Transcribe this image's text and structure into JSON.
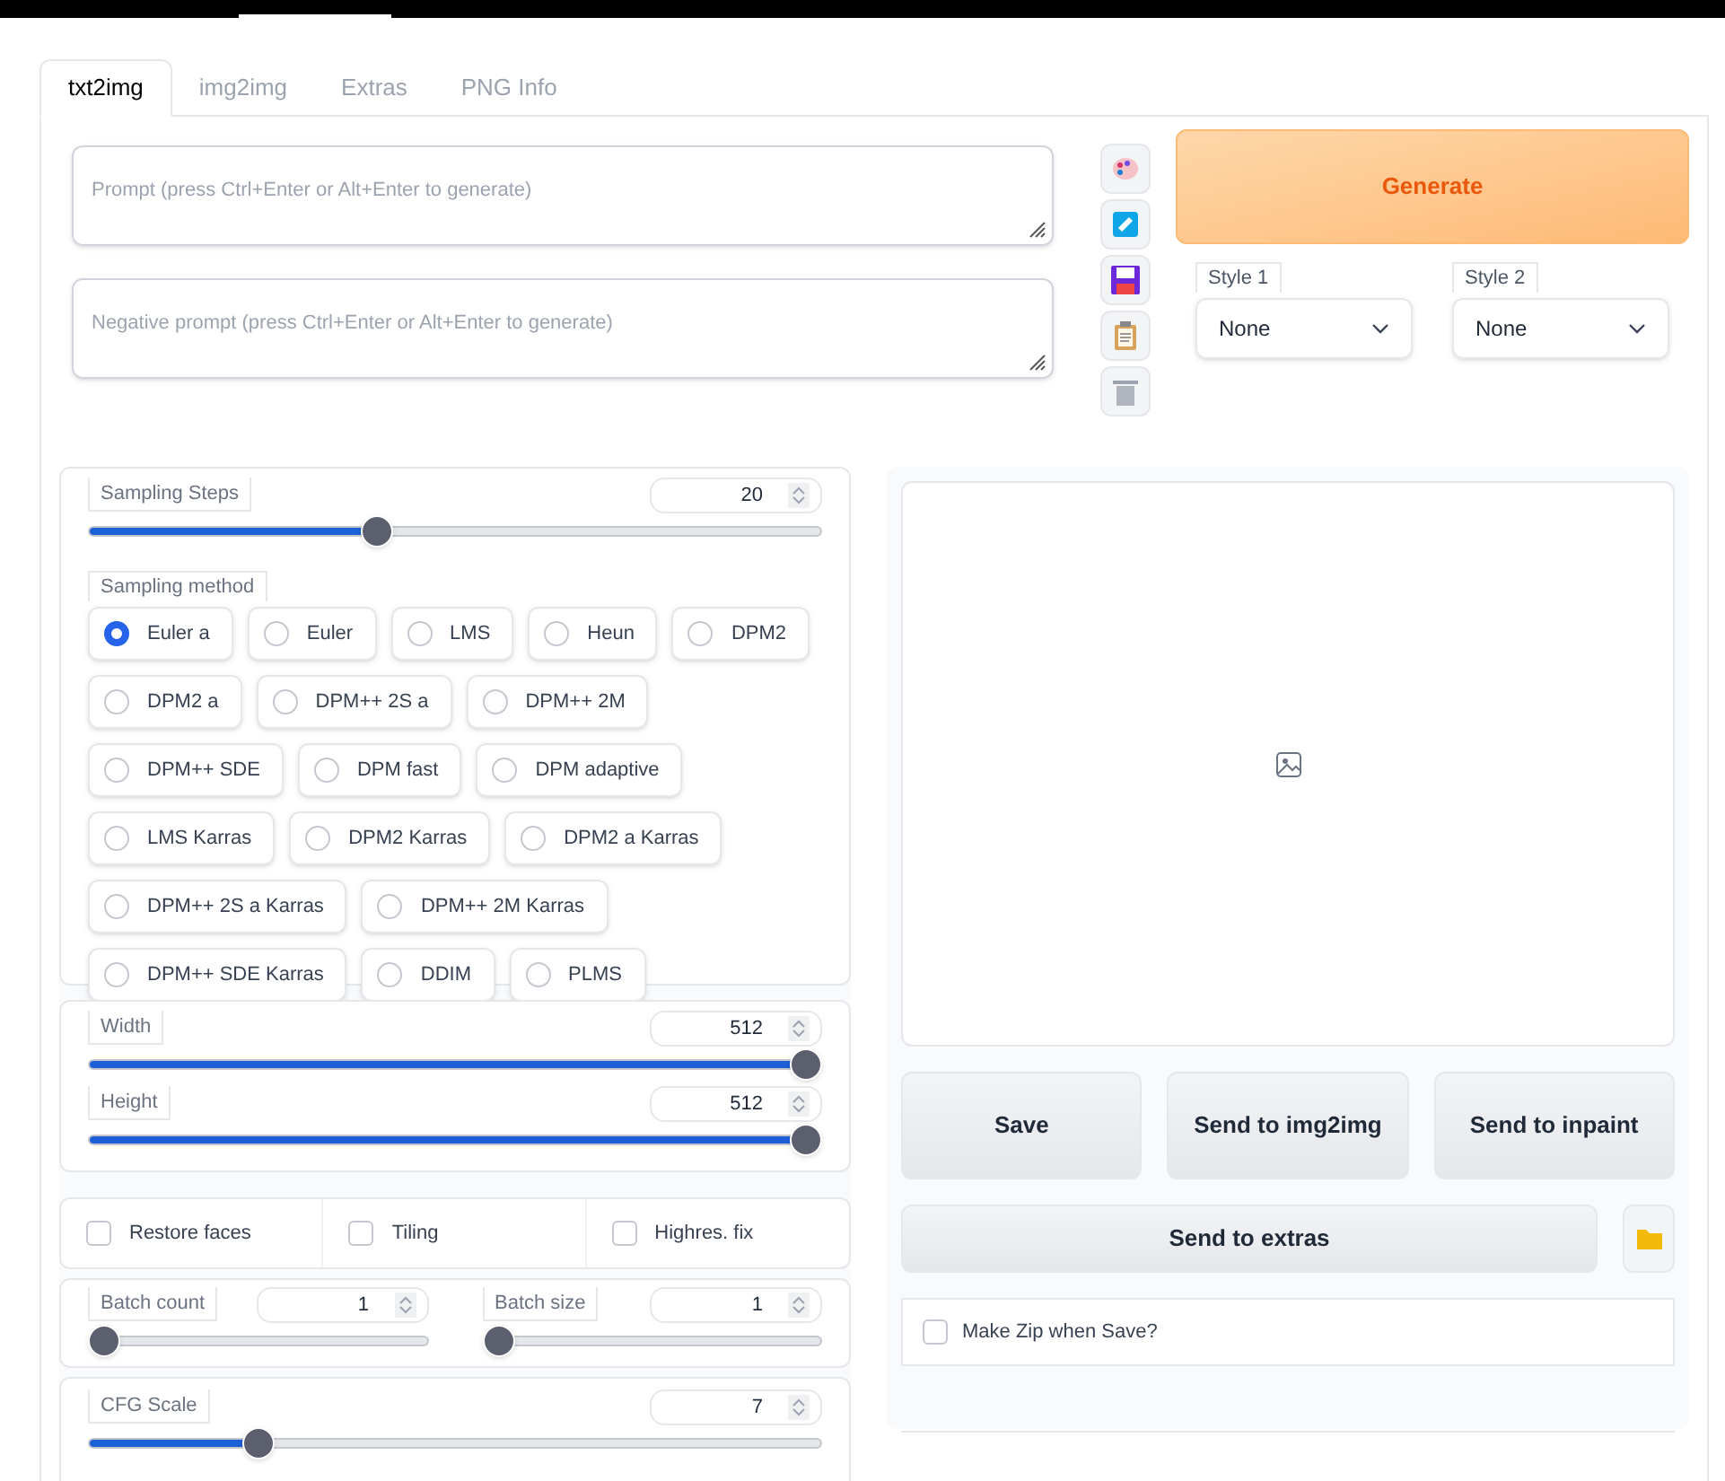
{
  "tabs": [
    {
      "label": "txt2img",
      "selected": true
    },
    {
      "label": "img2img",
      "selected": false
    },
    {
      "label": "Extras",
      "selected": false
    },
    {
      "label": "PNG Info",
      "selected": false
    }
  ],
  "prompt": {
    "placeholder": "Prompt (press Ctrl+Enter or Alt+Enter to generate)"
  },
  "negative_prompt": {
    "placeholder": "Negative prompt (press Ctrl+Enter or Alt+Enter to generate)"
  },
  "generate_button": "Generate",
  "styles": [
    {
      "label": "Style 1",
      "value": "None"
    },
    {
      "label": "Style 2",
      "value": "None"
    }
  ],
  "sampling_steps": {
    "label": "Sampling Steps",
    "value": "20",
    "level": 0.39
  },
  "sampling_method": {
    "label": "Sampling method",
    "options": [
      {
        "label": "Euler a",
        "selected": true
      },
      {
        "label": "Euler",
        "selected": false
      },
      {
        "label": "LMS",
        "selected": false
      },
      {
        "label": "Heun",
        "selected": false
      },
      {
        "label": "DPM2",
        "selected": false
      },
      {
        "label": "DPM2 a",
        "selected": false
      },
      {
        "label": "DPM++ 2S a",
        "selected": false
      },
      {
        "label": "DPM++ 2M",
        "selected": false
      },
      {
        "label": "DPM++ SDE",
        "selected": false
      },
      {
        "label": "DPM fast",
        "selected": false
      },
      {
        "label": "DPM adaptive",
        "selected": false
      },
      {
        "label": "LMS Karras",
        "selected": false
      },
      {
        "label": "DPM2 Karras",
        "selected": false
      },
      {
        "label": "DPM2 a Karras",
        "selected": false
      },
      {
        "label": "DPM++ 2S a Karras",
        "selected": false
      },
      {
        "label": "DPM++ 2M Karras",
        "selected": false
      },
      {
        "label": "DPM++ SDE Karras",
        "selected": false
      },
      {
        "label": "DDIM",
        "selected": false
      },
      {
        "label": "PLMS",
        "selected": false
      }
    ]
  },
  "width": {
    "label": "Width",
    "value": "512",
    "level": 1
  },
  "height": {
    "label": "Height",
    "value": "512",
    "level": 1
  },
  "options": [
    {
      "label": "Restore faces",
      "checked": false
    },
    {
      "label": "Tiling",
      "checked": false
    },
    {
      "label": "Highres. fix",
      "checked": false
    }
  ],
  "batch_count": {
    "label": "Batch count",
    "value": "1",
    "level": 0
  },
  "batch_size": {
    "label": "Batch size",
    "value": "1",
    "level": 0
  },
  "cfg_scale": {
    "label": "CFG Scale",
    "value": "7",
    "level": 0.22
  },
  "output_buttons": [
    "Save",
    "Send to img2img",
    "Send to inpaint"
  ],
  "send_to_extras": "Send to extras",
  "make_zip": {
    "label": "Make Zip when Save?",
    "checked": false
  }
}
